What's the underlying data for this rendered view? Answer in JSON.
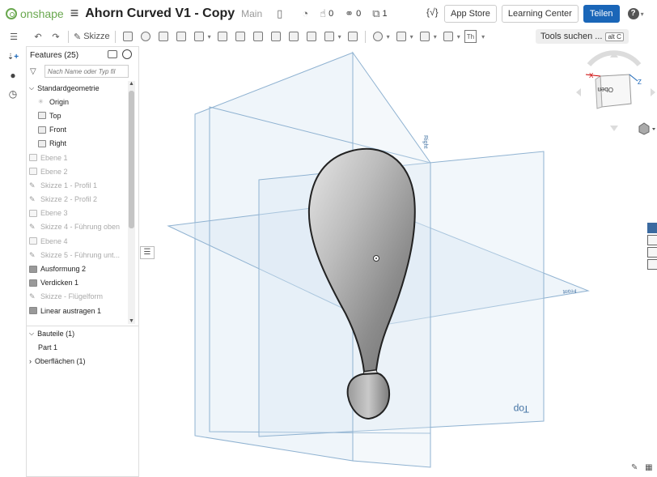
{
  "topbar": {
    "brand": "onshape",
    "doc_title": "Ahorn Curved V1 - Copy",
    "branch": "Main",
    "likes": "0",
    "links": "0",
    "copies": "1",
    "fx_label": "{√}",
    "app_store": "App Store",
    "learning_center": "Learning Center",
    "share": "Teilen",
    "help": "?"
  },
  "toolbar": {
    "sketch_label": "Skizze",
    "tools_search": "Tools suchen ...",
    "shortcut": "alt C",
    "th_label": "Th"
  },
  "panel": {
    "title": "Features (25)",
    "filter_placeholder": "Nach Name oder Typ fil",
    "features": [
      {
        "label": "Standardgeometrie",
        "kind": "group"
      },
      {
        "label": "Origin",
        "kind": "origin"
      },
      {
        "label": "Top",
        "kind": "plane"
      },
      {
        "label": "Front",
        "kind": "plane"
      },
      {
        "label": "Right",
        "kind": "plane"
      },
      {
        "label": "Ebene 1",
        "kind": "plane-dim"
      },
      {
        "label": "Ebene 2",
        "kind": "plane-dim"
      },
      {
        "label": "Skizze 1 - Profil 1",
        "kind": "sketch-dim"
      },
      {
        "label": "Skizze 2 - Profil 2",
        "kind": "sketch-dim"
      },
      {
        "label": "Ebene 3",
        "kind": "plane-dim"
      },
      {
        "label": "Skizze 4 - Führung oben",
        "kind": "sketch-dim"
      },
      {
        "label": "Ebene 4",
        "kind": "plane-dim"
      },
      {
        "label": "Skizze 5 - Führung unt...",
        "kind": "sketch-dim"
      },
      {
        "label": "Ausformung 2",
        "kind": "feature"
      },
      {
        "label": "Verdicken 1",
        "kind": "feature"
      },
      {
        "label": "Skizze - Flügelform",
        "kind": "sketch-dim"
      },
      {
        "label": "Linear austragen 1",
        "kind": "feature"
      }
    ],
    "parts_header": "Bauteile (1)",
    "part_item": "Part 1",
    "surfaces_header": "Oberflächen (1)"
  },
  "viewport": {
    "plane_labels": {
      "top": "Top",
      "front": "Front",
      "right": "Right"
    }
  },
  "viewcube": {
    "face_label": "Oben",
    "x_axis": "X",
    "z_axis": "Z"
  },
  "colors": {
    "accent": "#1a66b8",
    "brand": "#6aa84f",
    "plane_fill": "#dbe8f3",
    "plane_stroke": "#8fb2d1"
  }
}
